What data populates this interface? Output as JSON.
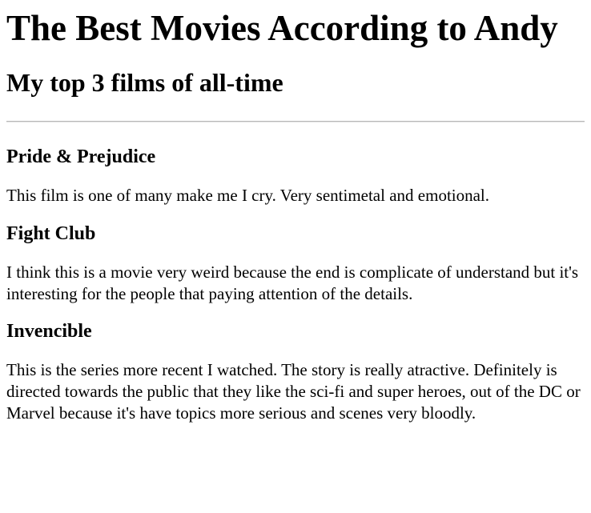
{
  "page": {
    "title": "The Best Movies According to Andy",
    "subtitle": "My top 3 films of all-time"
  },
  "films": [
    {
      "title": "Pride & Prejudice",
      "description": "This film is one of many make me I cry. Very sentimetal and emotional."
    },
    {
      "title": "Fight Club",
      "description": "I think this is a movie very weird because the end is complicate of understand but it's interesting for the people that paying attention of the details."
    },
    {
      "title": "Invencible",
      "description": "This is the series more recent I watched. The story is really atractive. Definitely is directed towards the public that they like the sci-fi and super heroes, out of the DC or Marvel because it's have topics more serious and scenes very bloodly."
    }
  ]
}
